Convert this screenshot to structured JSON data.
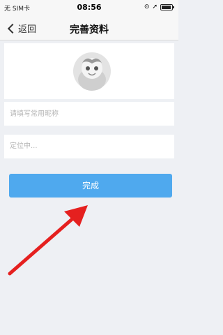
{
  "status_bar": {
    "carrier": "无 SIM卡",
    "time": "08:56"
  },
  "nav": {
    "back_label": "返回",
    "title": "完善资料"
  },
  "form": {
    "nickname_placeholder": "请填写常用昵称",
    "location_text": "定位中..."
  },
  "actions": {
    "done_label": "完成"
  },
  "colors": {
    "primary_button": "#4fa9ee",
    "annotation_arrow": "#e5201f"
  }
}
